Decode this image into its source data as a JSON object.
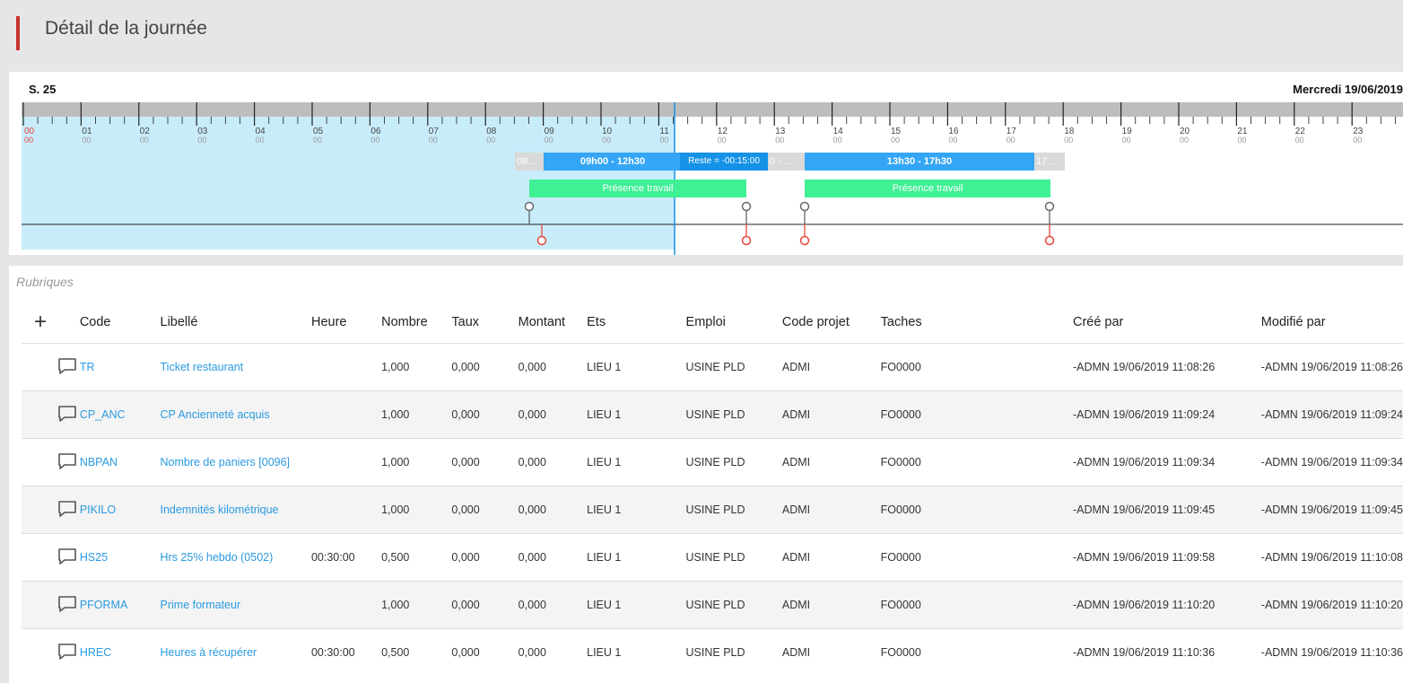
{
  "header": {
    "title": "Détail de la journée"
  },
  "timeline": {
    "week": "S. 25",
    "day": "Mercredi 19/06/2019",
    "hours": [
      "00",
      "01",
      "02",
      "03",
      "04",
      "05",
      "06",
      "07",
      "08",
      "09",
      "10",
      "11",
      "12",
      "13",
      "14",
      "15",
      "16",
      "17",
      "18",
      "19",
      "20",
      "21",
      "22",
      "23"
    ],
    "minutes": "00",
    "bars": {
      "grey1": "08...",
      "blue1": "09h00 - 12h30",
      "reste": "Reste = -00:15:00",
      "grey2": "0 - ...",
      "blue2": "13h30 - 17h30",
      "grey3": "17..."
    },
    "presence": [
      "Présence travail",
      "Présence travail"
    ]
  },
  "section_label": "Rubriques",
  "table": {
    "add_icon": "+",
    "columns": [
      "Code",
      "Libellé",
      "Heure",
      "Nombre",
      "Taux",
      "Montant",
      "Ets",
      "Emploi",
      "Code projet",
      "Taches",
      "Créé par",
      "Modifié par"
    ],
    "rows": [
      {
        "code": "TR",
        "libelle": "Ticket restaurant",
        "heure": "",
        "nombre": "1,000",
        "taux": "0,000",
        "montant": "0,000",
        "ets": "LIEU 1",
        "emploi": "USINE PLD",
        "projet": "ADMI",
        "taches": "FO0000",
        "cree": "-ADMN 19/06/2019 11:08:26",
        "modifie": "-ADMN 19/06/2019 11:08:26"
      },
      {
        "code": "CP_ANC",
        "libelle": "CP Ancienneté acquis",
        "heure": "",
        "nombre": "1,000",
        "taux": "0,000",
        "montant": "0,000",
        "ets": "LIEU 1",
        "emploi": "USINE PLD",
        "projet": "ADMI",
        "taches": "FO0000",
        "cree": "-ADMN 19/06/2019 11:09:24",
        "modifie": "-ADMN 19/06/2019 11:09:24"
      },
      {
        "code": "NBPAN",
        "libelle": "Nombre de paniers [0096]",
        "heure": "",
        "nombre": "1,000",
        "taux": "0,000",
        "montant": "0,000",
        "ets": "LIEU 1",
        "emploi": "USINE PLD",
        "projet": "ADMI",
        "taches": "FO0000",
        "cree": "-ADMN 19/06/2019 11:09:34",
        "modifie": "-ADMN 19/06/2019 11:09:34"
      },
      {
        "code": "PIKILO",
        "libelle": "Indemnités kilométrique",
        "heure": "",
        "nombre": "1,000",
        "taux": "0,000",
        "montant": "0,000",
        "ets": "LIEU 1",
        "emploi": "USINE PLD",
        "projet": "ADMI",
        "taches": "FO0000",
        "cree": "-ADMN 19/06/2019 11:09:45",
        "modifie": "-ADMN 19/06/2019 11:09:45"
      },
      {
        "code": "HS25",
        "libelle": "Hrs 25% hebdo (0502)",
        "heure": "00:30:00",
        "nombre": "0,500",
        "taux": "0,000",
        "montant": "0,000",
        "ets": "LIEU 1",
        "emploi": "USINE PLD",
        "projet": "ADMI",
        "taches": "FO0000",
        "cree": "-ADMN 19/06/2019 11:09:58",
        "modifie": "-ADMN 19/06/2019 11:10:08"
      },
      {
        "code": "PFORMA",
        "libelle": "Prime formateur",
        "heure": "",
        "nombre": "1,000",
        "taux": "0,000",
        "montant": "0,000",
        "ets": "LIEU 1",
        "emploi": "USINE PLD",
        "projet": "ADMI",
        "taches": "FO0000",
        "cree": "-ADMN 19/06/2019 11:10:20",
        "modifie": "-ADMN 19/06/2019 11:10:20"
      },
      {
        "code": "HREC",
        "libelle": "Heures à récupérer",
        "heure": "00:30:00",
        "nombre": "0,500",
        "taux": "0,000",
        "montant": "0,000",
        "ets": "LIEU 1",
        "emploi": "USINE PLD",
        "projet": "ADMI",
        "taches": "FO0000",
        "cree": "-ADMN 19/06/2019 11:10:36",
        "modifie": "-ADMN 19/06/2019 11:10:36"
      }
    ]
  },
  "colors": {
    "accent": "#c8322f",
    "link": "#2a9ae0",
    "pastZone": "#c9ecfa",
    "blueBar": "#34a6f5",
    "presence": "#3ff095",
    "punchOut": "#e8463c"
  }
}
